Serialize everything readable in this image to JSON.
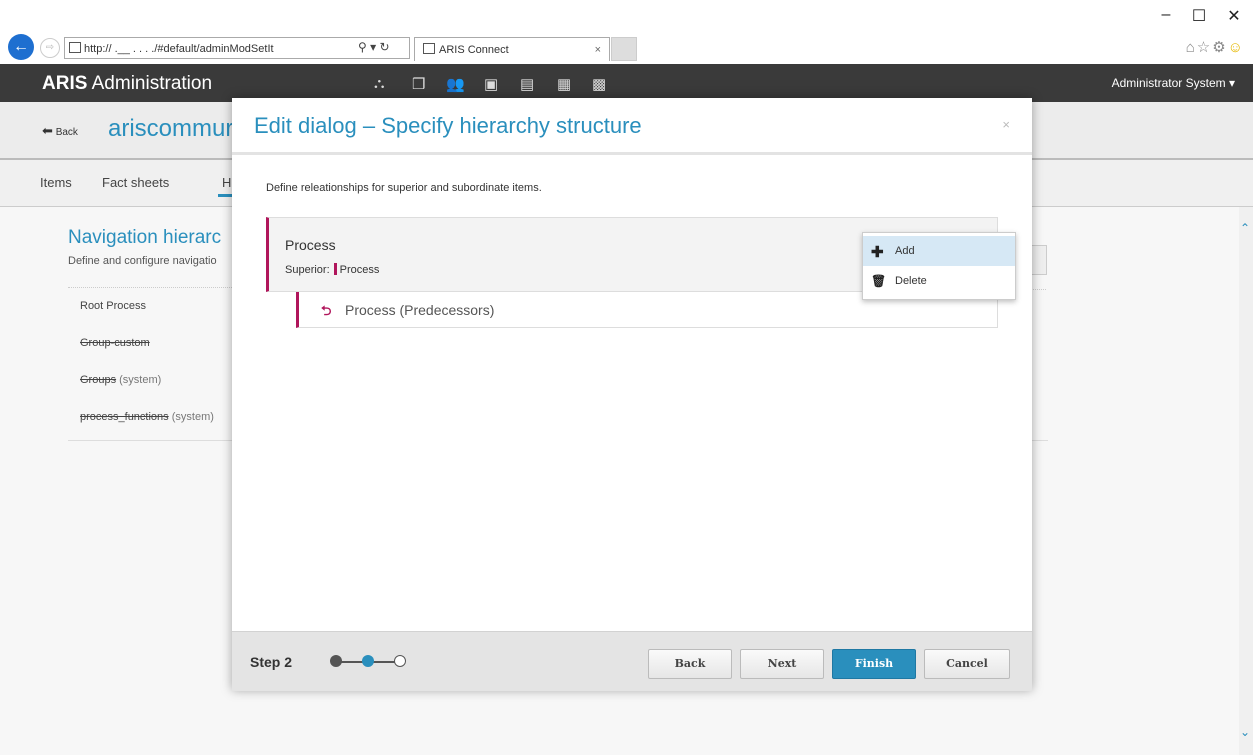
{
  "browser": {
    "address": "http://              .__ . . . ./#default/adminModSetIt",
    "tab_title": "ARIS Connect",
    "tab_close": "×",
    "window_controls": [
      "–",
      "☐",
      "✕"
    ]
  },
  "topbar": {
    "brand": "ARIS",
    "title": " Administration",
    "user": "Administrator System ▾"
  },
  "background": {
    "back_label": "Back",
    "title": "ariscommur",
    "tabs": [
      "Items",
      "Fact sheets",
      "H"
    ],
    "nav_title": "Navigation hierarc",
    "nav_sub": "Define and configure navigatio",
    "nav_items": [
      {
        "label": "Root Process",
        "strike": false,
        "suffix": ""
      },
      {
        "label": "Group-custom",
        "strike": true,
        "suffix": ""
      },
      {
        "label": "Groups",
        "strike": true,
        "suffix": " (system)"
      },
      {
        "label": "process_functions",
        "strike": true,
        "suffix": " (system)"
      }
    ]
  },
  "dialog": {
    "title": "Edit dialog – Specify hierarchy structure",
    "close": "×",
    "description": "Define releationships for superior and subordinate items.",
    "item": {
      "title": "Process",
      "superior_label": "Superior:",
      "superior_value": "Process"
    },
    "sub_item": {
      "label": "Process (Predecessors)"
    },
    "menu": [
      {
        "label": "Add",
        "icon": "plus-icon",
        "glyph": "✚"
      },
      {
        "label": "Delete",
        "icon": "trash-icon",
        "glyph": "🗑"
      }
    ],
    "footer": {
      "step_label": "Step 2",
      "step_current": 2,
      "step_total": 3,
      "back": "Back",
      "next": "Next",
      "finish": "Finish",
      "cancel": "Cancel"
    }
  },
  "colors": {
    "accent": "#2a8fbd",
    "marker": "#b0155b",
    "topbar": "#3a3a3a"
  }
}
